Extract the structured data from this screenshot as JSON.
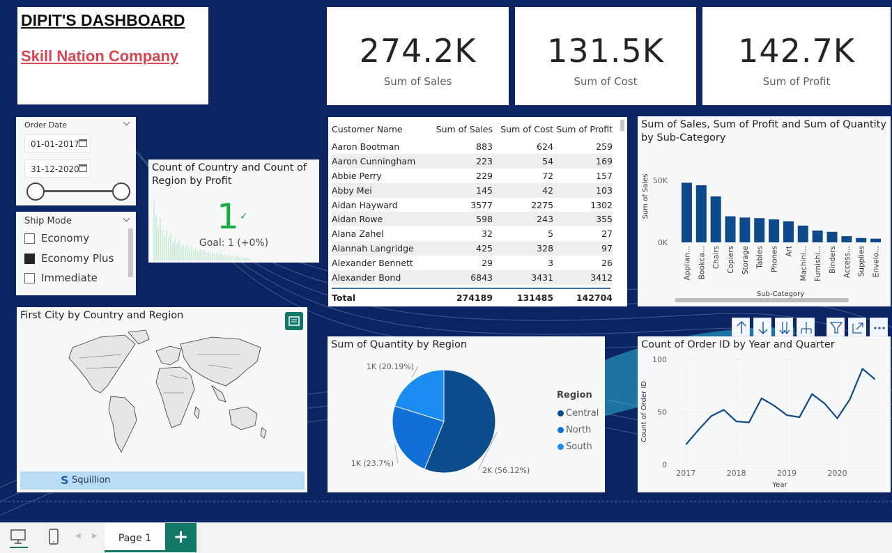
{
  "title_card": {
    "title": "DIPIT'S DASHBOARD",
    "subtitle": "Skill Nation Company"
  },
  "kpis": [
    {
      "value": "274.2K",
      "label": "Sum of Sales"
    },
    {
      "value": "131.5K",
      "label": "Sum of Cost"
    },
    {
      "value": "142.7K",
      "label": "Sum of Profit"
    }
  ],
  "date_slicer": {
    "title": "Order Date",
    "start": "01-01-2017",
    "end": "31-12-2020"
  },
  "ship_slicer": {
    "title": "Ship Mode",
    "options": [
      {
        "label": "Economy",
        "checked": false
      },
      {
        "label": "Economy Plus",
        "checked": true
      },
      {
        "label": "Immediate",
        "checked": false
      }
    ]
  },
  "kpi_visual": {
    "title": "Count of Country and Count of Region by Profit",
    "value": "1",
    "goal": "Goal: 1 (+0%)"
  },
  "table": {
    "headers": [
      "Customer Name",
      "Sum of Sales",
      "Sum of Cost",
      "Sum of Profit"
    ],
    "rows": [
      [
        "Aaron Bootman",
        "883",
        "624",
        "259"
      ],
      [
        "Aaron Cunningham",
        "223",
        "54",
        "169"
      ],
      [
        "Abbie Perry",
        "229",
        "72",
        "157"
      ],
      [
        "Abby Mei",
        "145",
        "42",
        "103"
      ],
      [
        "Aidan Hayward",
        "3577",
        "2275",
        "1302"
      ],
      [
        "Aidan Rowe",
        "598",
        "243",
        "355"
      ],
      [
        "Alana Zahel",
        "32",
        "5",
        "27"
      ],
      [
        "Alannah Langridge",
        "425",
        "328",
        "97"
      ],
      [
        "Alexander Bennett",
        "29",
        "3",
        "26"
      ],
      [
        "Alexander Bond",
        "6843",
        "3431",
        "3412"
      ]
    ],
    "total": [
      "Total",
      "274189",
      "131485",
      "142704"
    ]
  },
  "map": {
    "title": "First City by Country and Region",
    "brand": "Squillion"
  },
  "chart_data": [
    {
      "type": "bar",
      "title": "Sum of Sales, Sum of Profit and Sum of Quantity by Sub-Category",
      "xlabel": "Sub-Category",
      "ylabel": "Sum of Sales",
      "categories": [
        "Applian...",
        "Bookca...",
        "Chairs",
        "Copiers",
        "Storage",
        "Tables",
        "Phones",
        "Art",
        "Machini...",
        "Furnishi...",
        "Binders",
        "Access...",
        "Supplies",
        "Envelo..."
      ],
      "values": [
        48000,
        46000,
        37000,
        21000,
        20000,
        19500,
        18500,
        17000,
        13500,
        9500,
        8500,
        5000,
        3500,
        3000
      ],
      "ylim": [
        0,
        60000
      ],
      "yticks": [
        "0K",
        "50K"
      ],
      "color": "#0e4a8b"
    },
    {
      "type": "pie",
      "title": "Sum of Quantity by Region",
      "legend_title": "Region",
      "slices": [
        {
          "name": "Central",
          "value": 56.12,
          "label": "2K (56.12%)",
          "color": "#0b4c8c"
        },
        {
          "name": "North",
          "value": 23.7,
          "label": "1K (23.7%)",
          "color": "#1170d6"
        },
        {
          "name": "South",
          "value": 20.19,
          "label": "1K (20.19%)",
          "color": "#1a8cf0"
        }
      ]
    },
    {
      "type": "line",
      "title": "Count of Order ID by Year and Quarter",
      "xlabel": "Year",
      "ylabel": "Count of Order ID",
      "x": [
        2017.0,
        2017.25,
        2017.5,
        2017.75,
        2018.0,
        2018.25,
        2018.5,
        2018.75,
        2019.0,
        2019.25,
        2019.5,
        2019.75,
        2020.0,
        2020.25,
        2020.5,
        2020.75
      ],
      "y": [
        19,
        33,
        46,
        52,
        41,
        40,
        63,
        56,
        47,
        45,
        67,
        58,
        44,
        62,
        91,
        81
      ],
      "ylim": [
        0,
        100
      ],
      "yticks": [
        0,
        50,
        100
      ],
      "xticks": [
        "2017",
        "2018",
        "2019",
        "2020"
      ],
      "color": "#0e4a8b"
    }
  ],
  "tabs": {
    "page": "Page 1",
    "add": "+"
  }
}
